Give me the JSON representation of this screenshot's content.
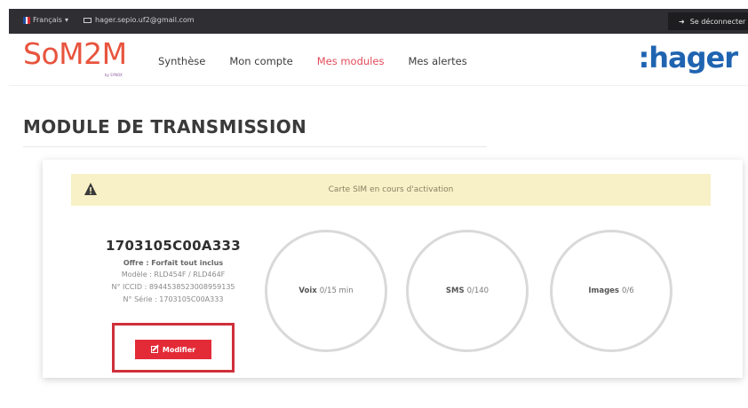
{
  "topbar": {
    "language": "Français",
    "email": "hager.sepio.uf2@gmail.com",
    "logout": "Se déconnecter"
  },
  "header": {
    "logo": "SoM2M",
    "logo_sub": "by SYNOX",
    "nav": [
      "Synthèse",
      "Mon compte",
      "Mes modules",
      "Mes alertes"
    ],
    "brand": ":hager"
  },
  "page": {
    "title": "MODULE DE TRANSMISSION"
  },
  "module": {
    "alert": "Carte SIM en cours d'activation",
    "serial_title": "1703105C00A333",
    "offer": "Offre : Forfait tout inclus",
    "model": "Modèle : RLD454F / RLD464F",
    "iccid": "N° ICCID : 8944538523008959135",
    "serial": "N° Série : 1703105C00A333",
    "edit_label": "Modifier",
    "usage": [
      {
        "label": "Voix",
        "value": "0/15 min"
      },
      {
        "label": "SMS",
        "value": "0/140"
      },
      {
        "label": "Images",
        "value": "0/6"
      }
    ]
  },
  "colors": {
    "accent": "#e32b38",
    "logo": "#e8543e",
    "brand": "#1f64b0",
    "alert_bg": "#f8f1c7",
    "topbar": "#2f2f33"
  },
  "icons": {
    "flag": "france-flag-icon",
    "mail": "mail-icon",
    "logout": "logout-icon",
    "warning": "warning-icon",
    "edit": "edit-icon"
  }
}
